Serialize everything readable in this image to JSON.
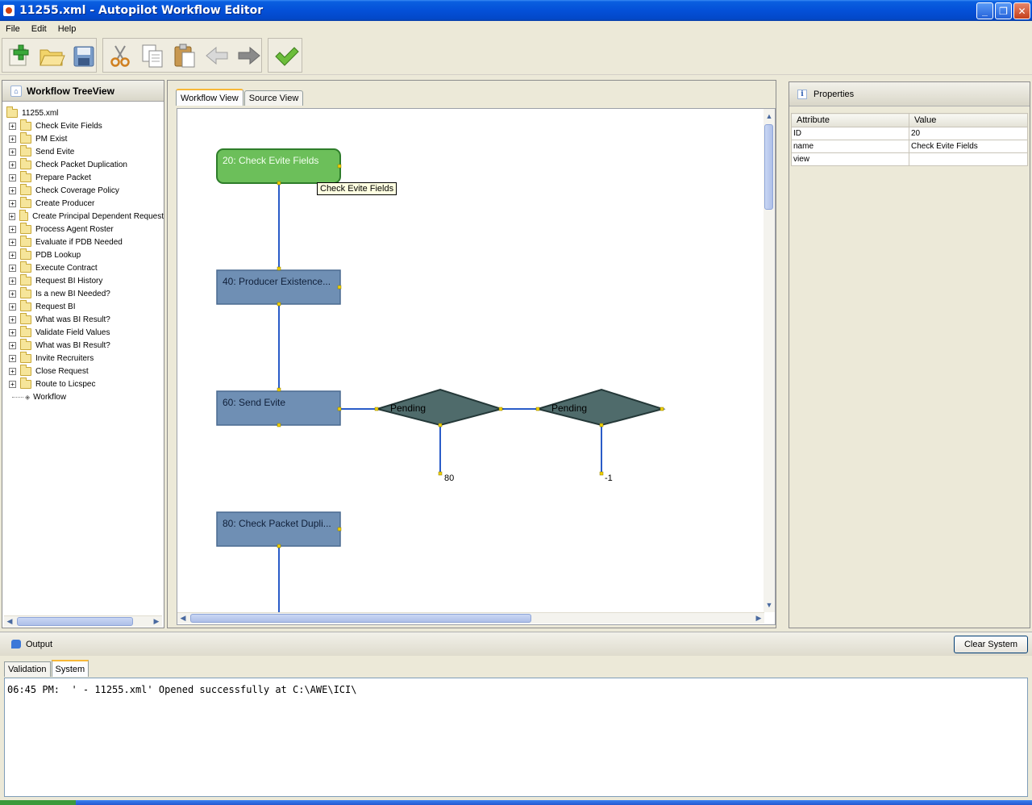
{
  "window": {
    "title": "11255.xml - Autopilot Workflow Editor"
  },
  "menu": [
    "File",
    "Edit",
    "Help"
  ],
  "tree_panel": {
    "title": "Workflow TreeView",
    "root": "11255.xml",
    "items": [
      "Check Evite Fields",
      "PM Exist",
      "Send Evite",
      "Check Packet Duplication",
      "Prepare Packet",
      "Check Coverage Policy",
      "Create Producer",
      "Create Principal Dependent Request",
      "Process Agent Roster",
      "Evaluate if PDB Needed",
      "PDB Lookup",
      "Execute Contract",
      "Request BI History",
      "Is a new BI Needed?",
      "Request BI",
      "What was BI Result?",
      "Validate Field Values",
      "What was BI Result?",
      "Invite Recruiters",
      "Close Request",
      "Route to Licspec"
    ],
    "leaf": "Workflow"
  },
  "editor": {
    "tabs": [
      "Workflow View",
      "Source View"
    ],
    "nodes": {
      "n20": "20: Check Evite Fields",
      "n40": "40: Producer Existence...",
      "n60": "60: Send Evite",
      "n80": "80: Check Packet Dupli..."
    },
    "decisions": {
      "d1": "Pending",
      "d2": "Pending"
    },
    "targets": {
      "t1": "80",
      "t2": "-1"
    },
    "tooltip": "Check Evite Fields",
    "colors": {
      "selected_node": "#6cbf5a",
      "node": "#6f8fb4",
      "decision": "#4f6b6b",
      "connector": "#2a5cc8",
      "port": "#f0d000"
    }
  },
  "properties": {
    "title": "Properties",
    "columns": [
      "Attribute",
      "Value"
    ],
    "rows": [
      {
        "attribute": "ID",
        "value": "20"
      },
      {
        "attribute": "name",
        "value": "Check Evite Fields"
      },
      {
        "attribute": "view",
        "value": ""
      }
    ]
  },
  "output": {
    "title": "Output",
    "clear_label": "Clear System",
    "tabs": [
      "Validation",
      "System"
    ],
    "text": "06:45 PM:  ' - 11255.xml' Opened successfully at C:\\AWE\\ICI\\"
  }
}
